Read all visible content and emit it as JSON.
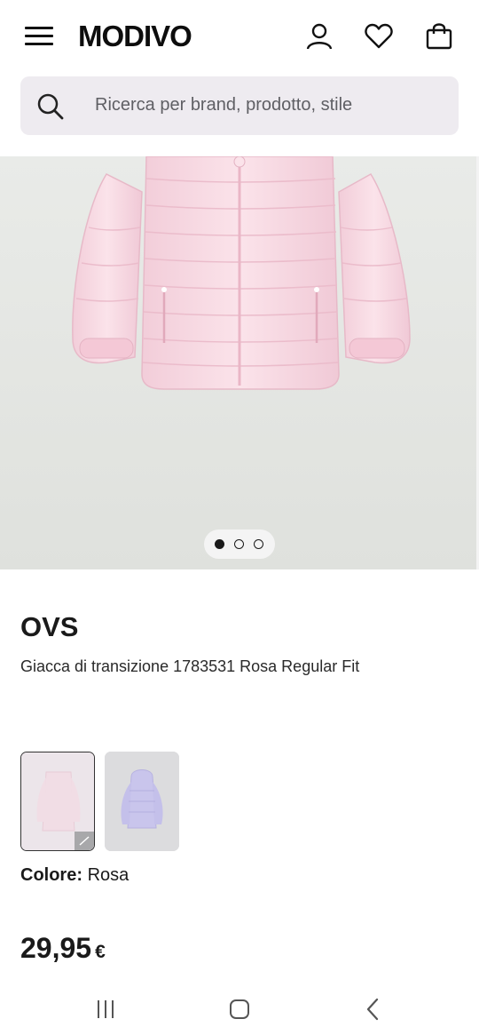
{
  "header": {
    "logo": "MODIVO",
    "icons": [
      "menu-icon",
      "user-icon",
      "heart-icon",
      "bag-icon"
    ]
  },
  "search": {
    "placeholder": "Ricerca per brand, prodotto, stile"
  },
  "gallery": {
    "slide_count": 3,
    "active_index": 0
  },
  "product": {
    "brand": "OVS",
    "title": "Giacca di transizione 1783531 Rosa Regular Fit",
    "color_label": "Colore:",
    "color_value": "Rosa",
    "price": "29,95",
    "currency": "€",
    "swatches": [
      {
        "color": "Rosa",
        "selected": true
      },
      {
        "color": "Lilla",
        "selected": false
      }
    ]
  },
  "colors": {
    "jacket_pink": "#f6d6e0",
    "jacket_lilac": "#c9c5ec",
    "search_bg": "#eeebf0",
    "gallery_bg": "#e4e6e2"
  },
  "system_nav": {
    "icons": [
      "recent-apps-icon",
      "home-icon",
      "back-icon"
    ]
  }
}
